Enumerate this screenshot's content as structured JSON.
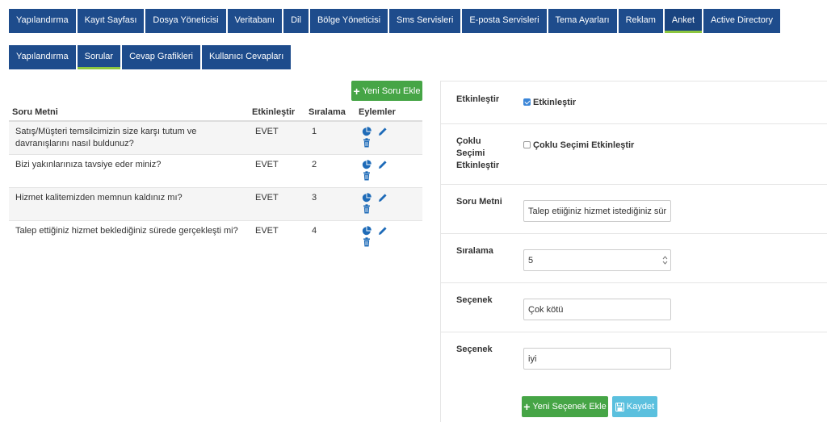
{
  "top_tabs": [
    {
      "label": "Yapılandırma"
    },
    {
      "label": "Kayıt Sayfası"
    },
    {
      "label": "Dosya Yöneticisi"
    },
    {
      "label": "Veritabanı"
    },
    {
      "label": "Dil"
    },
    {
      "label": "Bölge Yöneticisi"
    },
    {
      "label": "Sms Servisleri"
    },
    {
      "label": "E-posta Servisleri"
    },
    {
      "label": "Tema Ayarları"
    },
    {
      "label": "Reklam"
    },
    {
      "label": "Anket",
      "active": true
    },
    {
      "label": "Active Directory"
    }
  ],
  "sub_tabs": [
    {
      "label": "Yapılandırma"
    },
    {
      "label": "Sorular",
      "active": true
    },
    {
      "label": "Cevap Grafikleri"
    },
    {
      "label": "Kullanıcı Cevapları"
    }
  ],
  "questions": {
    "add_button": "Yeni Soru Ekle",
    "headers": {
      "text": "Soru Metni",
      "enabled": "Etkinleştir",
      "order": "Sıralama",
      "actions": "Eylemler"
    },
    "rows": [
      {
        "text": "Satış/Müşteri temsilcimizin size karşı tutum ve davranışlarını nasıl buldunuz?",
        "enabled": "EVET",
        "order": "1"
      },
      {
        "text": "Bizi yakınlarınıza tavsiye eder miniz?",
        "enabled": "EVET",
        "order": "2"
      },
      {
        "text": "Hizmet kalitemizden memnun kaldınız mı?",
        "enabled": "EVET",
        "order": "3"
      },
      {
        "text": "Talep ettiğiniz hizmet beklediğiniz sürede gerçekleşti mi?",
        "enabled": "EVET",
        "order": "4"
      }
    ]
  },
  "form": {
    "enable_label": "Etkinleştir",
    "enable_checkbox_label": "Etkinleştir",
    "enable_checked": true,
    "multi_label": "Çoklu Seçimi Etkinleştir",
    "multi_checkbox_label": "Çoklu Seçimi Etkinleştir",
    "multi_checked": false,
    "question_label": "Soru Metni",
    "question_value": "Talep etiiğiniz hizmet istediğiniz süre",
    "order_label": "Sıralama",
    "order_value": "5",
    "option1_label": "Seçenek",
    "option1_value": "Çok kötü",
    "option2_label": "Seçenek",
    "option2_value": "iyi",
    "add_option_button": "Yeni Seçenek Ekle",
    "save_button": "Kaydet"
  },
  "colors": {
    "nav": "#1e4c8c",
    "active_underline": "#8cc63f",
    "success": "#46a546",
    "info": "#5bc0de",
    "icon": "#1e6bb8"
  }
}
